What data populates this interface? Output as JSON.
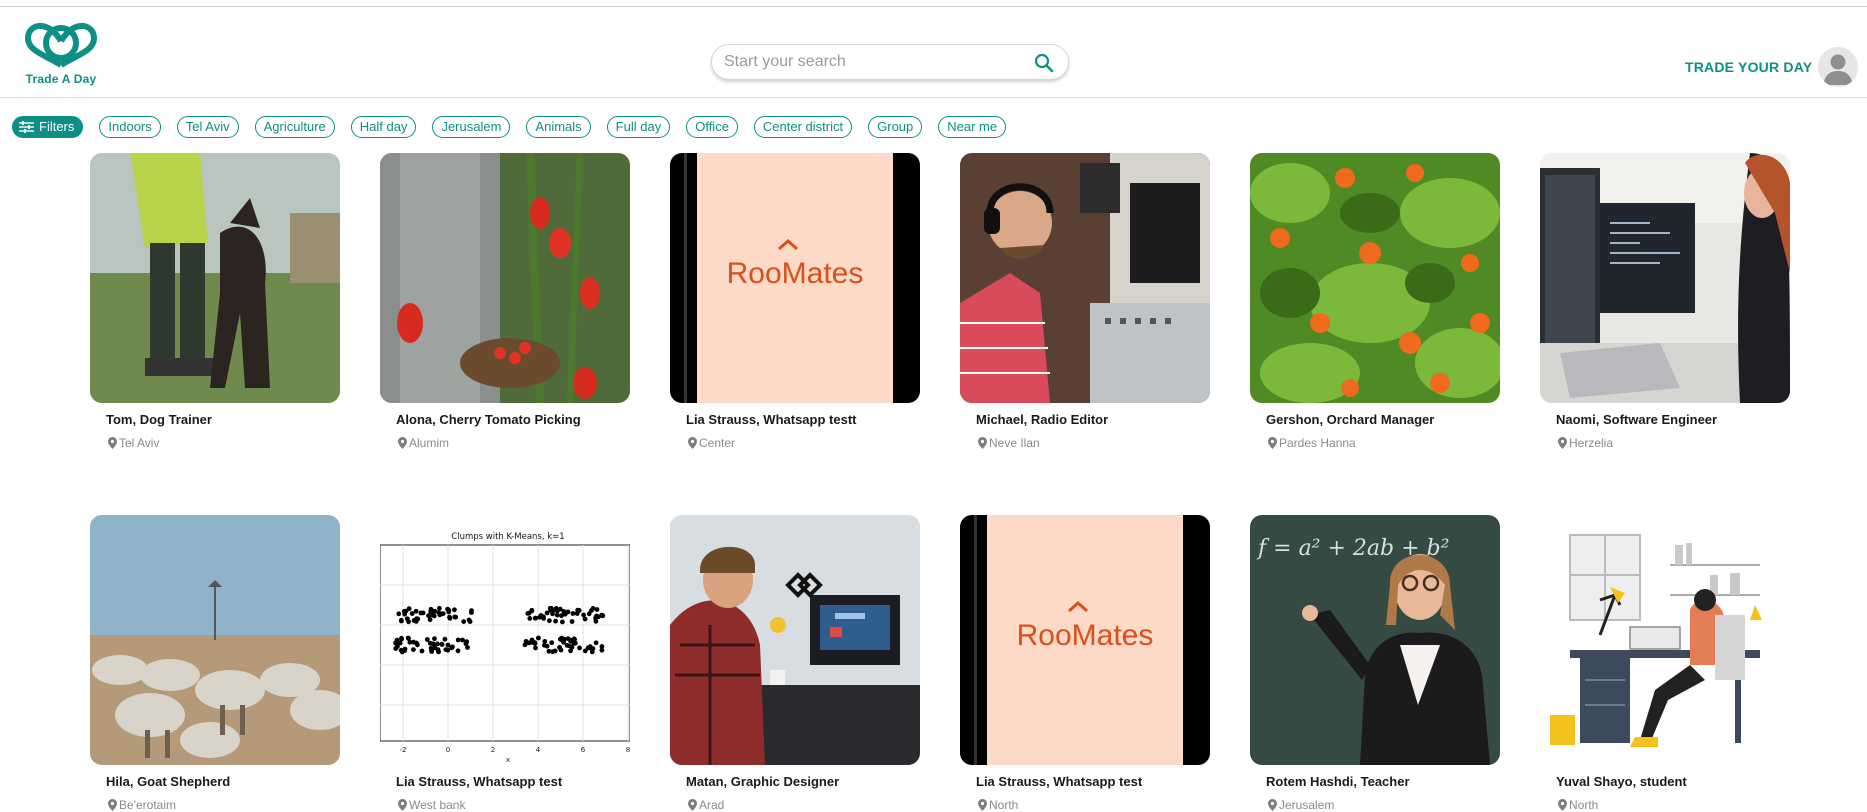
{
  "brand": {
    "name": "Trade A Day",
    "accent": "#0d8f86"
  },
  "search": {
    "placeholder": "Start your search"
  },
  "header": {
    "trade_link": "TRADE YOUR DAY"
  },
  "filters": {
    "button_label": "Filters",
    "chips": [
      "Indoors",
      "Tel Aviv",
      "Agriculture",
      "Half day",
      "Jerusalem",
      "Animals",
      "Full day",
      "Office",
      "Center district",
      "Group",
      "Near me"
    ]
  },
  "cards": [
    {
      "title": "Tom, Dog Trainer",
      "location": "Tel Aviv",
      "image": "dog-trainer-photo"
    },
    {
      "title": "Alona, Cherry Tomato Picking",
      "location": "Alumim",
      "image": "tomato-photo"
    },
    {
      "title": "Lia Strauss, Whatsapp testt",
      "location": "Center",
      "image": "roomates-logo"
    },
    {
      "title": "Michael, Radio Editor",
      "location": "Neve Ilan",
      "image": "radio-studio-photo"
    },
    {
      "title": "Gershon, Orchard Manager",
      "location": "Pardes Hanna",
      "image": "orange-tree-photo"
    },
    {
      "title": "Naomi, Software Engineer",
      "location": "Herzelia",
      "image": "office-desk-photo"
    },
    {
      "title": "Hila, Goat Shepherd",
      "location": "Be'erotaim",
      "image": "sheep-photo"
    },
    {
      "title": "Lia Strauss, Whatsapp test",
      "location": "West bank",
      "image": "kmeans-plot-image"
    },
    {
      "title": "Matan, Graphic Designer",
      "location": "Arad",
      "image": "designer-photo"
    },
    {
      "title": "Lia Strauss, Whatsapp test",
      "location": "North",
      "image": "roomates-logo"
    },
    {
      "title": "Rotem Hashdi, Teacher",
      "location": "Jerusalem",
      "image": "teacher-photo"
    },
    {
      "title": "Yuval Shayo, student",
      "location": "North",
      "image": "student-illustration"
    }
  ],
  "roomates_logo": {
    "prefix": "Roo",
    "suffix": "Mates"
  },
  "kmeans_plot": {
    "title": "Clumps with K-Means, k=1",
    "xlabel": "x",
    "xticks": [
      "-2",
      "0",
      "2",
      "4",
      "6",
      "8"
    ]
  },
  "teacher_board": {
    "formula": "f = a² + 2ab + b²"
  }
}
